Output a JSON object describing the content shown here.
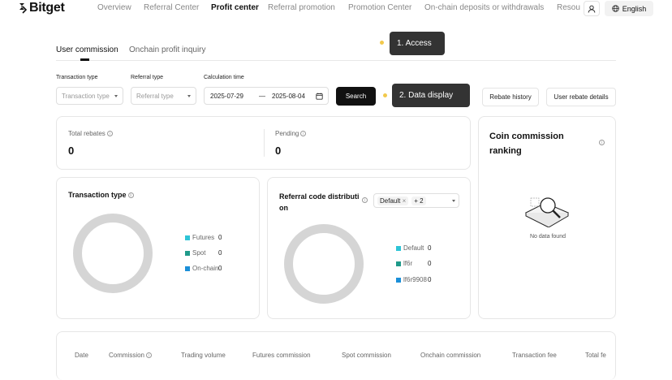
{
  "brand": "Bitget",
  "nav": {
    "items": [
      "Overview",
      "Referral Center",
      "Profit center",
      "Referral promotion",
      "Promotion Center",
      "On-chain deposits or withdrawals",
      "Resou"
    ],
    "language": "English"
  },
  "tabs": [
    "User commission",
    "Onchain profit inquiry"
  ],
  "filters": {
    "transaction_type_label": "Transaction type",
    "transaction_type_value": "Transaction type",
    "referral_type_label": "Referral type",
    "referral_type_value": "Referral type",
    "calc_time_label": "Calculation time",
    "date_from": "2025-07-29",
    "date_sep": "—",
    "date_to": "2025-08-04",
    "search": "Search",
    "rebate_history": "Rebate history",
    "user_rebate_details": "User rebate details"
  },
  "callouts": {
    "access": "1. Access",
    "data_display": "2. Data display"
  },
  "summary": {
    "total_rebates_label": "Total rebates",
    "total_rebates_value": "0",
    "pending_label": "Pending",
    "pending_value": "0"
  },
  "transaction_type_card": {
    "title": "Transaction type",
    "legend": [
      {
        "name": "Futures",
        "value": "0",
        "color": "#2ec4d6"
      },
      {
        "name": "Spot",
        "value": "0",
        "color": "#1f9a8a"
      },
      {
        "name": "On-chain",
        "value": "0",
        "color": "#1b8fd8"
      }
    ]
  },
  "referral_code_card": {
    "title_line1": "Referral code distributi",
    "title_line2": "on",
    "chip_default": "Default",
    "chip_more": "+ 2",
    "legend": [
      {
        "name": "Default",
        "value": "0",
        "color": "#2ec4d6"
      },
      {
        "name": "lf6r",
        "value": "0",
        "color": "#1f9a8a"
      },
      {
        "name": "lf6r9908",
        "value": "0",
        "color": "#1b8fd8"
      }
    ]
  },
  "ranking_card": {
    "title_line1": "Coin commission",
    "title_line2": "ranking",
    "empty_text": "No data found"
  },
  "table": {
    "columns": [
      "Date",
      "Commission",
      "Trading volume",
      "Futures commission",
      "Spot commission",
      "Onchain commission",
      "Transaction fee",
      "Total fe"
    ]
  }
}
